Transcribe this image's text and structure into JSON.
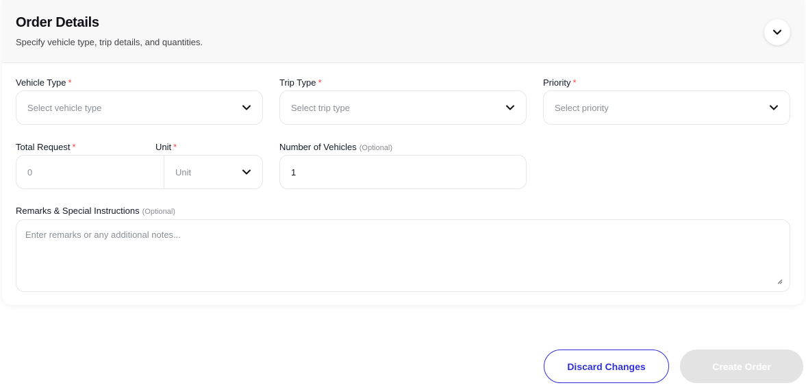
{
  "header": {
    "title": "Order Details",
    "subtitle": "Specify vehicle type, trip details, and quantities."
  },
  "fields": {
    "vehicle_type": {
      "label": "Vehicle Type",
      "required_mark": "*",
      "placeholder": "Select vehicle type"
    },
    "trip_type": {
      "label": "Trip Type",
      "required_mark": "*",
      "placeholder": "Select trip type"
    },
    "priority": {
      "label": "Priority",
      "required_mark": "*",
      "placeholder": "Select priority"
    },
    "total_request": {
      "label": "Total Request",
      "required_mark": "*",
      "placeholder": "0"
    },
    "unit": {
      "label": "Unit",
      "required_mark": "*",
      "placeholder": "Unit"
    },
    "number_of_vehicles": {
      "label": "Number of Vehicles",
      "optional": "(Optional)",
      "value": "1"
    },
    "remarks": {
      "label": "Remarks & Special Instructions",
      "optional": "(Optional)",
      "placeholder": "Enter remarks or any additional notes..."
    }
  },
  "actions": {
    "discard_label": "Discard Changes",
    "create_label": "Create Order"
  },
  "colors": {
    "accent": "#2f2fd9",
    "required": "#ef4444",
    "disabled_button": "#e3e3e3"
  }
}
